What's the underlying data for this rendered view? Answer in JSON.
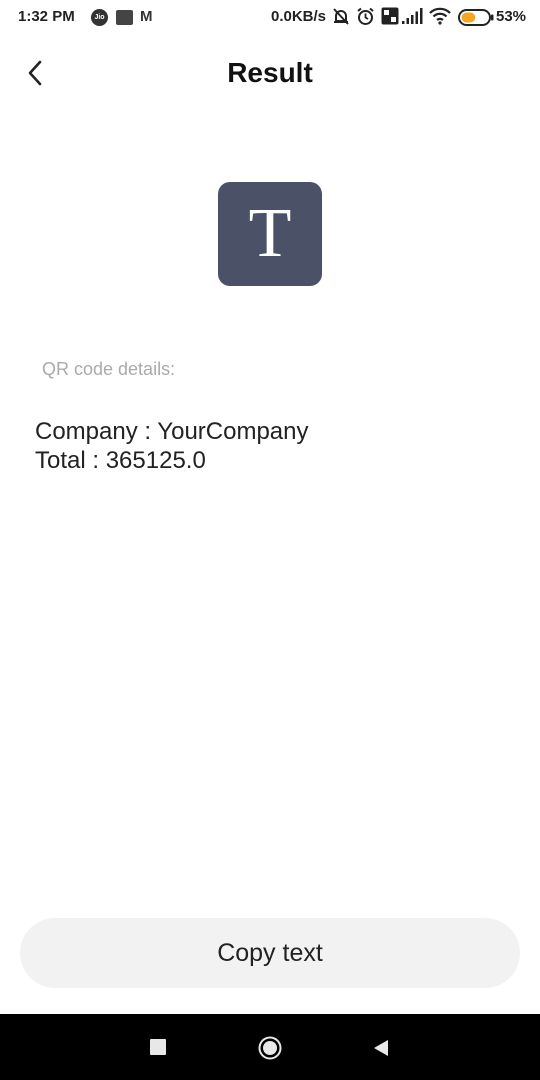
{
  "status_bar": {
    "time": "1:32 PM",
    "jio_label": "Jio",
    "myntra_label": "M",
    "net_speed": "0.0KB/s",
    "battery_percent": "53%",
    "icons": [
      "jio-icon",
      "paytm-icon",
      "myntra-icon",
      "alarm-off-icon",
      "alarm-icon",
      "volte-icon",
      "signal-icon",
      "wifi-icon",
      "battery-icon"
    ],
    "battery_color": "#f5a623",
    "battery_level": 0.53
  },
  "header": {
    "title": "Result",
    "back_icon": "chevron-left-icon"
  },
  "type_icon": {
    "letter": "T",
    "background": "#4b5166"
  },
  "details": {
    "label": "QR code details:",
    "lines": [
      "Company : YourCompany",
      "Total : 365125.0"
    ]
  },
  "actions": {
    "copy_label": "Copy text"
  },
  "nav_bar": {
    "icons": [
      "recents-icon",
      "home-icon",
      "back-triangle-icon"
    ]
  }
}
